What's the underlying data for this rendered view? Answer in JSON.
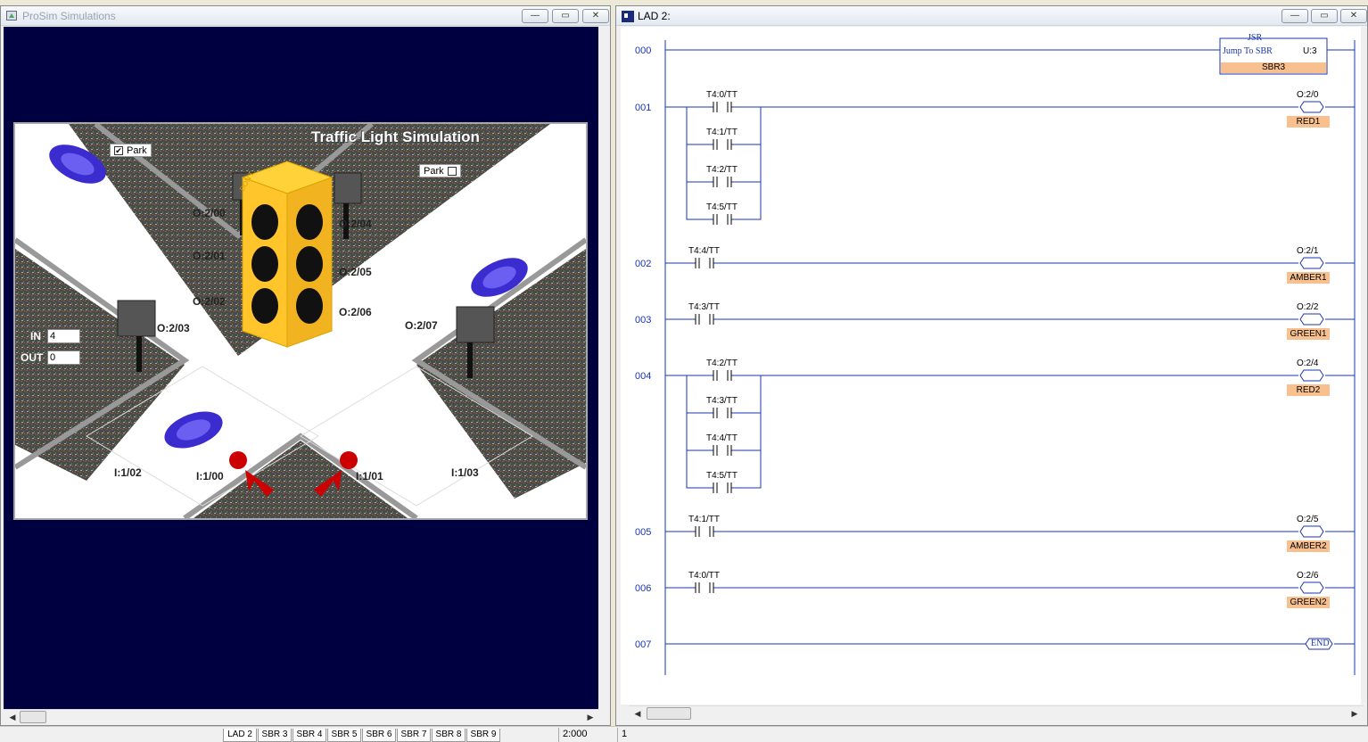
{
  "prosim": {
    "title": "ProSim Simulations",
    "scene_title": "Traffic Light Simulation",
    "park_top_label": "Park",
    "park_top_checked": true,
    "park_right_label": "Park",
    "park_right_checked": false,
    "outputs": [
      "O:2/00",
      "O:2/01",
      "O:2/02",
      "O:2/03",
      "O:2/04",
      "O:2/05",
      "O:2/06",
      "O:2/07"
    ],
    "inputs": [
      "I:1/00",
      "I:1/01",
      "I:1/02",
      "I:1/03"
    ],
    "in_label": "IN",
    "in_value": "4",
    "out_label": "OUT",
    "out_value": "0",
    "sign_text": "DON'T"
  },
  "lad": {
    "title": "LAD 2:",
    "jsr": {
      "name": "JSR",
      "desc": "Jump To SBR",
      "unit": "U:3",
      "target": "SBR3"
    },
    "rungs": [
      {
        "num": "000"
      },
      {
        "num": "001",
        "contacts": [
          "T4:0/TT",
          "T4:1/TT",
          "T4:2/TT",
          "T4:5/TT"
        ],
        "coil_addr": "O:2/0",
        "coil_name": "RED1"
      },
      {
        "num": "002",
        "contacts": [
          "T4:4/TT"
        ],
        "coil_addr": "O:2/1",
        "coil_name": "AMBER1"
      },
      {
        "num": "003",
        "contacts": [
          "T4:3/TT"
        ],
        "coil_addr": "O:2/2",
        "coil_name": "GREEN1"
      },
      {
        "num": "004",
        "contacts": [
          "T4:2/TT",
          "T4:3/TT",
          "T4:4/TT",
          "T4:5/TT"
        ],
        "coil_addr": "O:2/4",
        "coil_name": "RED2"
      },
      {
        "num": "005",
        "contacts": [
          "T4:1/TT"
        ],
        "coil_addr": "O:2/5",
        "coil_name": "AMBER2"
      },
      {
        "num": "006",
        "contacts": [
          "T4:0/TT"
        ],
        "coil_addr": "O:2/6",
        "coil_name": "GREEN2"
      },
      {
        "num": "007",
        "end": "END"
      }
    ]
  },
  "status": {
    "tabs": [
      "LAD 2",
      "SBR 3",
      "SBR 4",
      "SBR 5",
      "SBR 6",
      "SBR 7",
      "SBR 8",
      "SBR 9"
    ],
    "position": "2:000",
    "page": "1"
  },
  "icons": [
    "app-icon",
    "minimize-icon",
    "maximize-icon",
    "close-icon",
    "scroll-left-icon",
    "scroll-right-icon",
    "checkbox-icon"
  ]
}
